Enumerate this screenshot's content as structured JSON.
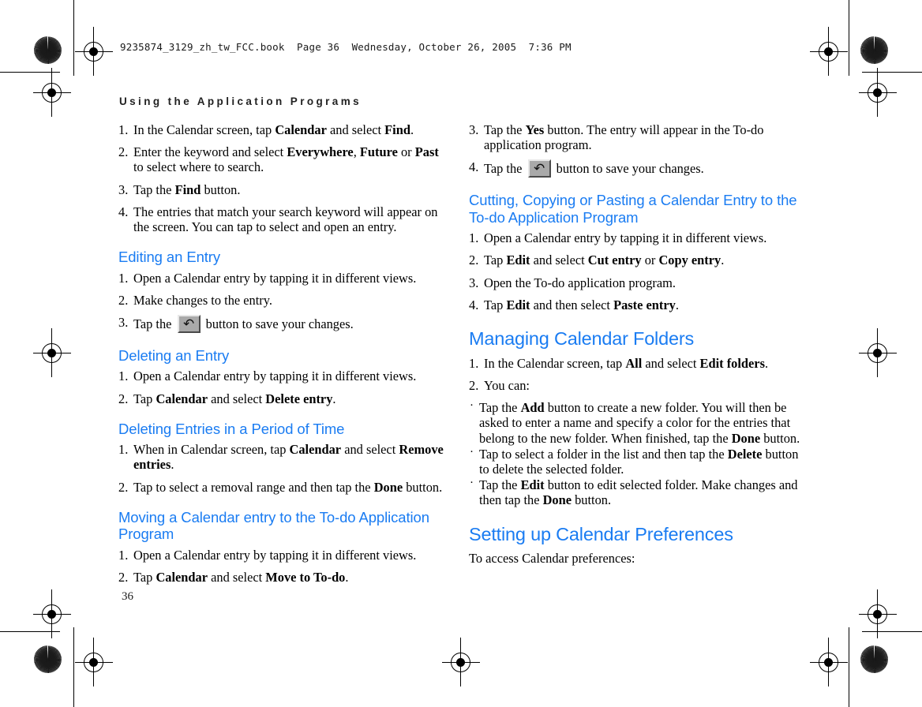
{
  "print_header": "9235874_3129_zh_tw_FCC.book  Page 36  Wednesday, October 26, 2005  7:36 PM",
  "running_head": "Using the Application Programs",
  "page_number": "36",
  "colors": {
    "heading_blue": "#1a7cf2",
    "body_black": "#000000"
  },
  "icons": {
    "save_button_glyph": "↶",
    "bullet_glyph": "·"
  },
  "left_column": {
    "find_steps": [
      {
        "num": "1.",
        "html": "In the Calendar screen, tap <b>Calendar</b> and select <b>Find</b>."
      },
      {
        "num": "2.",
        "html": "Enter the keyword and select <b>Everywhere</b>, <b>Future</b> or <b>Past</b> to select where to search."
      },
      {
        "num": "3.",
        "html": "Tap the <b>Find</b> button."
      },
      {
        "num": "4.",
        "html": "The entries that match your search keyword will appear on the screen. You can tap to select and open an entry."
      }
    ],
    "editing_heading": "Editing an Entry",
    "editing_steps": [
      {
        "num": "1.",
        "html": "Open a Calendar entry by tapping it in different views."
      },
      {
        "num": "2.",
        "html": "Make changes to the entry."
      },
      {
        "num": "3.",
        "html": "Tap the __BTN__ button to save your changes."
      }
    ],
    "deleting_heading": "Deleting an Entry",
    "deleting_steps": [
      {
        "num": "1.",
        "html": "Open a Calendar entry by tapping it in different views."
      },
      {
        "num": "2.",
        "html": "Tap <b>Calendar</b> and select <b>Delete entry</b>."
      }
    ],
    "deleting_period_heading": "Deleting Entries in a Period of Time",
    "deleting_period_steps": [
      {
        "num": "1.",
        "html": "When in Calendar screen, tap <b>Calendar</b> and select <b>Remove entries</b>."
      },
      {
        "num": "2.",
        "html": "Tap to select a removal range and then tap the <b>Done</b> button."
      }
    ],
    "moving_heading": "Moving a Calendar entry to the To-do Application Program",
    "moving_steps": [
      {
        "num": "1.",
        "html": "Open a Calendar entry by tapping it in different views."
      },
      {
        "num": "2.",
        "html": "Tap <b>Calendar</b> and select <b>Move to To-do</b>."
      }
    ]
  },
  "right_column": {
    "moving_steps_cont": [
      {
        "num": "3.",
        "html": "Tap the <b>Yes</b> button. The entry will appear in the To-do application program."
      },
      {
        "num": "4.",
        "html": "Tap the __BTN__ button to save your changes."
      }
    ],
    "cutting_heading": "Cutting, Copying or Pasting a Calendar Entry to the To-do Application Program",
    "cutting_steps": [
      {
        "num": "1.",
        "html": "Open a Calendar entry by tapping it in different views."
      },
      {
        "num": "2.",
        "html": "Tap <b>Edit</b> and select <b>Cut entry</b> or <b>Copy entry</b>."
      },
      {
        "num": "3.",
        "html": "Open the To-do application program."
      },
      {
        "num": "4.",
        "html": "Tap <b>Edit</b> and then select <b>Paste entry</b>."
      }
    ],
    "managing_heading": "Managing Calendar Folders",
    "managing_steps": [
      {
        "num": "1.",
        "html": "In the Calendar screen, tap <b>All</b> and select <b>Edit folders</b>."
      },
      {
        "num": "2.",
        "html": "You can:"
      }
    ],
    "managing_bullets": [
      "Tap the <b>Add</b> button to create a new folder. You will then be asked to enter a name and specify a color for the entries that belong to the new folder. When finished, tap the <b>Done</b> button.",
      "Tap to select a folder in the list and then tap the <b>Delete</b> button to delete the selected folder.",
      "Tap the <b>Edit</b> button to edit selected folder. Make changes and then tap the <b>Done</b> button."
    ],
    "preferences_heading": "Setting up Calendar Preferences",
    "preferences_intro": "To access Calendar preferences:"
  }
}
